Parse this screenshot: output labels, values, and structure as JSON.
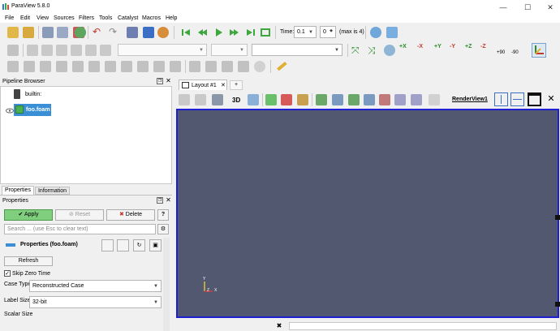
{
  "app": {
    "title": "ParaView 5.8.0",
    "icon": "paraview-logo-icon"
  },
  "window_controls": {
    "minimize": "—",
    "maximize": "☐",
    "close": "✕"
  },
  "menu": [
    "File",
    "Edit",
    "View",
    "Sources",
    "Filters",
    "Tools",
    "Catalyst",
    "Macros",
    "Help"
  ],
  "time_toolbar": {
    "time_label": "Time:",
    "time_value": "0.1",
    "step_value": "0",
    "max_label": "(max is 4)"
  },
  "camera_labels": {
    "plus_x": "+X",
    "minus_x": "-X",
    "plus_y": "+Y",
    "minus_y": "-Y",
    "plus_z": "+Z",
    "minus_z": "-Z",
    "rot_pos": "+90",
    "rot_neg": "-90"
  },
  "pipeline_browser": {
    "title": "Pipeline Browser",
    "items": [
      {
        "label": "builtin:",
        "icon": "server-icon",
        "selected": false
      },
      {
        "label": "foo.foam",
        "icon": "eye-icon",
        "selected": true
      }
    ]
  },
  "properties_panel": {
    "tabs": [
      "Properties",
      "Information"
    ],
    "title": "Properties",
    "apply_label": "Apply",
    "reset_label": "Reset",
    "delete_label": "Delete",
    "help_label": "?",
    "search_placeholder": "Search ... (use Esc to clear text)",
    "section_title": "Properties (foo.foam)",
    "refresh_label": "Refresh",
    "skip_zero_time": {
      "label": "Skip Zero Time",
      "checked": true
    },
    "case_type": {
      "label": "Case Type",
      "value": "Reconstructed Case"
    },
    "label_size": {
      "label": "Label Size",
      "value": "32-bit"
    },
    "scalar_size": {
      "label": "Scalar Size"
    }
  },
  "layout": {
    "tab_label": "Layout #1",
    "add_tab_label": "+",
    "view_3d_label": "3D",
    "render_view_label": "RenderView1"
  },
  "axes": {
    "y": "Y",
    "z": "Z",
    "x": "X"
  },
  "colors": {
    "view_bg": "#525870",
    "view_border": "#1e1ed2",
    "selection": "#3a8fd6",
    "apply_green": "#7fcf7f"
  }
}
